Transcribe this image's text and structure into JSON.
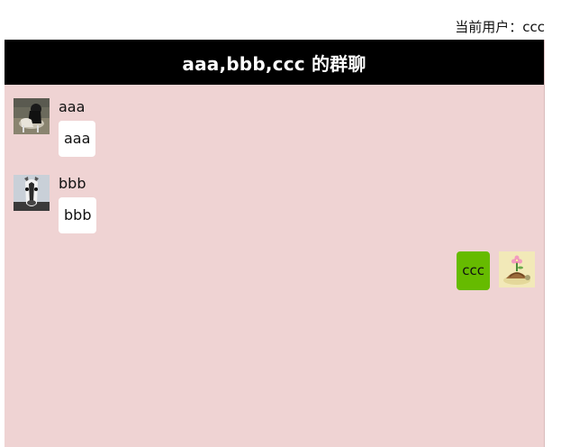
{
  "header": {
    "current_user_label": "当前用户：ccc"
  },
  "chat": {
    "title": "aaa,bbb,ccc 的群聊",
    "messages": [
      {
        "sender": "aaa",
        "text": "aaa",
        "avatar": "horse-rider-photo"
      },
      {
        "sender": "bbb",
        "text": "bbb",
        "avatar": "white-horse-photo"
      },
      {
        "sender": "ccc",
        "text": "ccc",
        "avatar": "cartoon-turtle-flower"
      }
    ]
  },
  "colors": {
    "header_bg": "#000000",
    "chat_bg": "#efd3d3",
    "incoming_bubble": "#ffffff",
    "outgoing_bubble": "#66bb00"
  }
}
